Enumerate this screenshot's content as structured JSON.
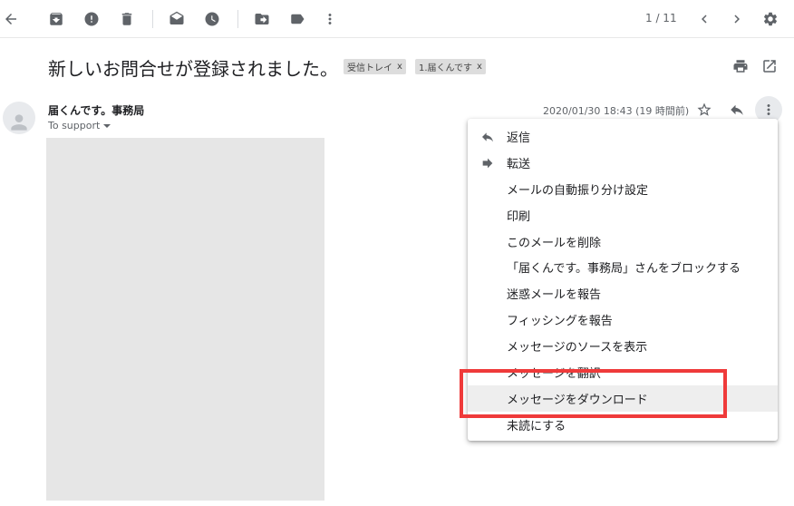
{
  "toolbar": {
    "icons": [
      "back-arrow-icon",
      "archive-icon",
      "report-spam-icon",
      "delete-icon",
      "mark-unread-icon",
      "snooze-icon",
      "move-to-icon",
      "label-icon",
      "more-vert-icon",
      "chevron-left-icon",
      "chevron-right-icon",
      "settings-icon"
    ],
    "pager": "1 / 11"
  },
  "email": {
    "subject": "新しいお問合せが登録されました。",
    "labels": [
      {
        "text": "受信トレイ",
        "remove": "x"
      },
      {
        "text": "1.届くんです",
        "remove": "x"
      }
    ],
    "sender": "届くんです。事務局",
    "to": "To support",
    "date": "2020/01/30 18:43 (19 時間前)"
  },
  "menu": {
    "items": [
      {
        "label": "返信",
        "icon": "reply-icon"
      },
      {
        "label": "転送",
        "icon": "forward-icon"
      },
      {
        "label": "メールの自動振り分け設定"
      },
      {
        "label": "印刷"
      },
      {
        "label": "このメールを削除"
      },
      {
        "label": "「届くんです。事務局」さんをブロックする"
      },
      {
        "label": "迷惑メールを報告"
      },
      {
        "label": "フィッシングを報告"
      },
      {
        "label": "メッセージのソースを表示"
      },
      {
        "label": "メッセージを翻訳"
      },
      {
        "label": "メッセージをダウンロード",
        "hovered": true
      },
      {
        "label": "未読にする"
      }
    ]
  },
  "colors": {
    "highlight_border": "#ef3a3a",
    "icon_gray": "#5f6368",
    "menu_hover": "#eeeeee",
    "label_chip": "#dddddd"
  }
}
